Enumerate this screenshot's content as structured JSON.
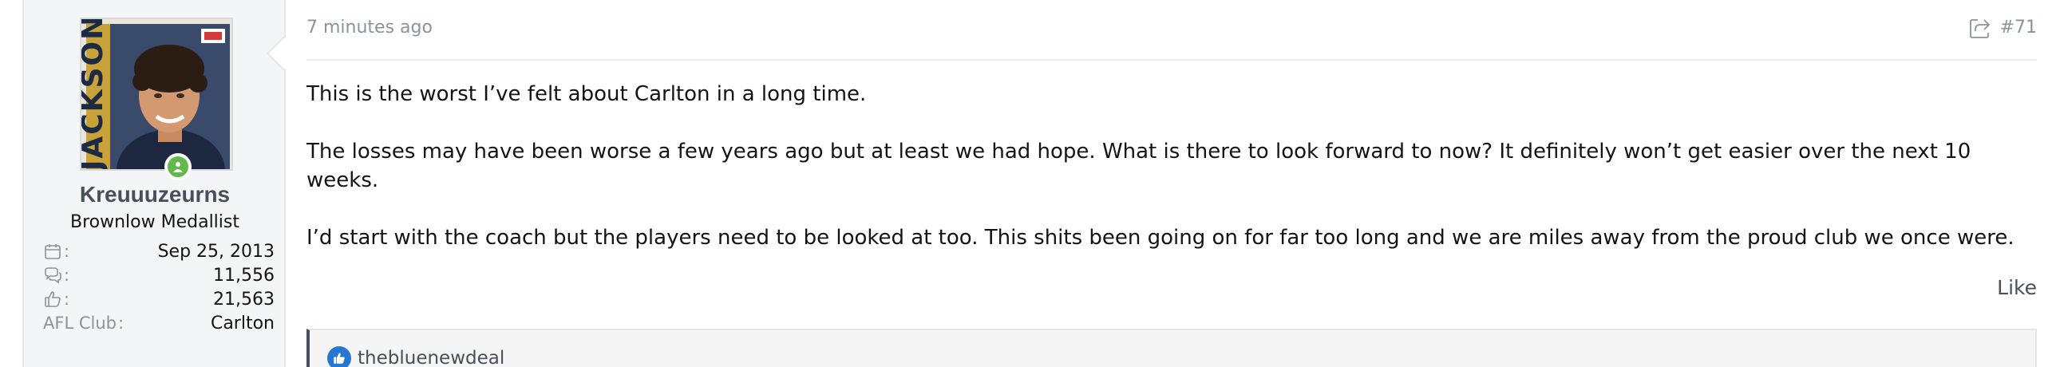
{
  "user": {
    "username": "Kreuuuzeurns",
    "title": "Brownlow Medallist",
    "avatar_text": "JACKSON",
    "stats": [
      {
        "icon": "calendar-icon",
        "label": "",
        "value": "Sep 25, 2013"
      },
      {
        "icon": "messages-icon",
        "label": "",
        "value": "11,556"
      },
      {
        "icon": "thumbs-up-icon",
        "label": "",
        "value": "21,563"
      },
      {
        "icon": "",
        "label": "AFL Club",
        "value": "Carlton"
      }
    ]
  },
  "post": {
    "timestamp": "7 minutes ago",
    "number": "#71",
    "paragraphs": [
      "This is the worst I’ve felt about Carlton in a long time.",
      "The losses may have been worse a few years ago but at least we had hope. What is there to look forward to now? It definitely won’t get easier over the next 10 weeks.",
      "I’d start with the coach but the players need to be looked at too. This shits been going on for far too long and we are miles away from the proud club we once were."
    ],
    "like_label": "Like",
    "reactions": {
      "user": "thebluenewdeal"
    }
  },
  "colors": {
    "accent": "#47505a",
    "muted": "#8b939c",
    "online": "#63b94c",
    "reaction": "#2577d1"
  }
}
